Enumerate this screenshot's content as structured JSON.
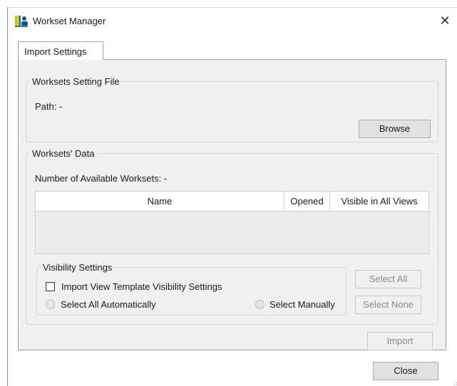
{
  "window": {
    "title": "Workset Manager",
    "close_glyph": "✕",
    "app_icon": "workset-icon"
  },
  "tabs": [
    {
      "label": "Import Settings",
      "selected": true
    }
  ],
  "setting_file": {
    "legend": "Worksets Setting File",
    "path_label": "Path: -",
    "browse_label": "Browse"
  },
  "worksets_data": {
    "legend": "Worksets' Data",
    "available_label": "Number of Available Worksets: -",
    "columns": [
      "Name",
      "Opened",
      "Visible in All Views"
    ],
    "rows": []
  },
  "visibility": {
    "legend": "Visibility Settings",
    "import_template_label": "Import View Template Visibility Settings",
    "import_template_checked": false,
    "select_auto_label": "Select All Automatically",
    "select_manual_label": "Select Manually",
    "select_all_label": "Select All",
    "select_none_label": "Select None"
  },
  "footer": {
    "import_label": "Import",
    "close_label": "Close"
  },
  "colors": {
    "panel_bg": "#f0f0f0",
    "button_bg": "#e1e1e1",
    "disabled_text": "#8a8a8a",
    "icon_green": "#2e8b57",
    "icon_yellow": "#f0b400",
    "icon_blue": "#1f4e9c"
  }
}
